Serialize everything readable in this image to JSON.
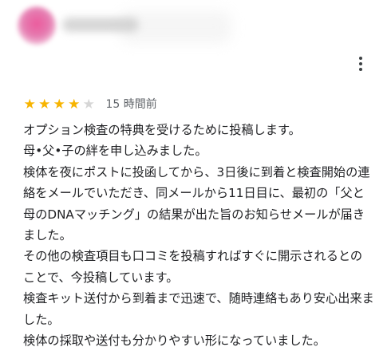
{
  "reviewer": {
    "avatar_icon": "avatar-blurred",
    "name_icon": "name-blurred"
  },
  "menu": {
    "icon": "more-vert-icon"
  },
  "rating": {
    "value": 4,
    "max": 5,
    "filled_color": "#f7b400",
    "empty_color": "#d6d6d6",
    "time": "15 時間前"
  },
  "review": {
    "text": "オプション検査の特典を受けるために投稿します。\n母•父•子の絆を申し込みました。\n検体を夜にポストに投函してから、3日後に到着と検査開始の連絡をメールでいただき、同メールから11日目に、最初の「父と母のDNAマッチング」の結果が出た旨のお知らせメールが届きました。\nその他の検査項目も口コミを投稿すればすぐに開示されるとのことで、今投稿しています。\n検査キット送付から到着まで迅速で、随時連絡もあり安心出来ました。\n検体の採取や送付も分かりやすい形になっていました。"
  }
}
